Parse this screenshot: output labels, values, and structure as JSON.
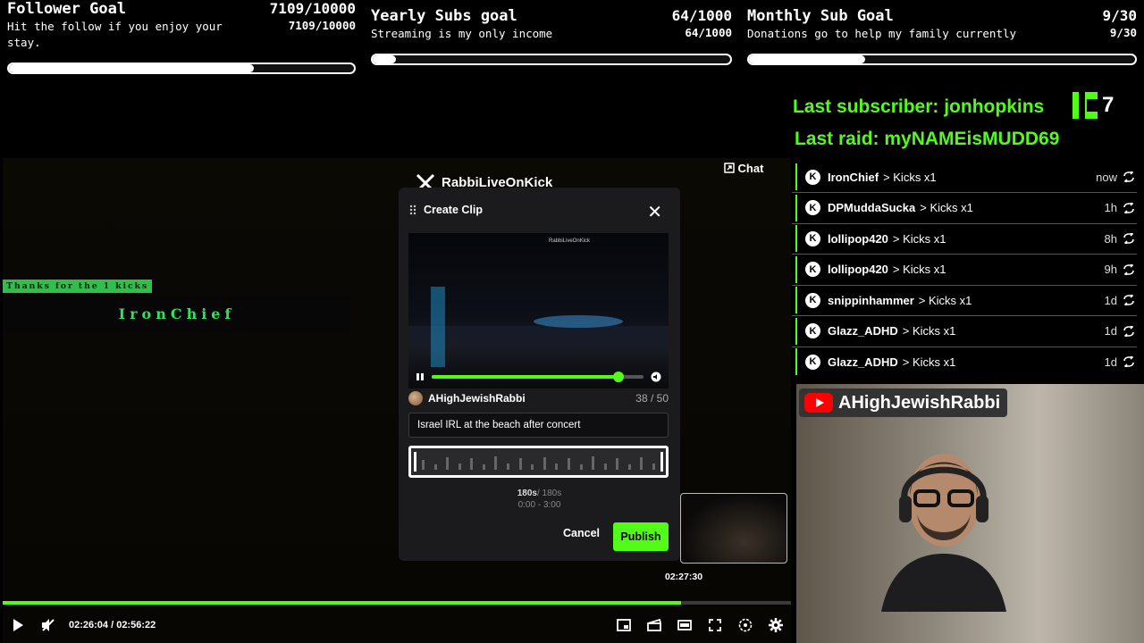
{
  "goals": [
    {
      "title": "Follower Goal",
      "count": "7109/10000",
      "desc": "Hit the follow if you enjoy your stay.",
      "count2": "7109/10000",
      "progress": 0.7109
    },
    {
      "title": "Yearly Subs goal",
      "count": "64/1000",
      "desc": "Streaming is my only income",
      "count2": "64/1000",
      "progress": 0.064
    },
    {
      "title": "Monthly Sub Goal",
      "count": "9/30",
      "desc": "Donations go to help my family currently",
      "count2": "9/30",
      "progress": 0.3
    }
  ],
  "alerts": {
    "last_subscriber": "Last subscriber: jonhopkins",
    "kick_count": "7",
    "last_raid": "Last raid: myNAMEisMUDD69",
    "accent": "#53fc18"
  },
  "overlay": {
    "thanks": "Thanks for the 1 kicks",
    "thanks_name": "IronChief"
  },
  "player": {
    "chat_label": "Chat",
    "channel": "RabbiLiveOnKick",
    "time": "02:26:04 / 02:56:22",
    "progress": 0.861,
    "thumb_time": "02:27:30"
  },
  "modal": {
    "title": "Create Clip",
    "author": "AHighJewishRabbi",
    "char_count": "38 / 50",
    "clip_title": "Israel IRL at the beach after concert",
    "clip_progress": 0.88,
    "duration_bold": "180s",
    "duration_max": "/ 180s",
    "range": "0:00 - 3:00",
    "cancel": "Cancel",
    "publish": "Publish"
  },
  "events": [
    {
      "user": "IronChief",
      "kicks": "> Kicks x1",
      "time": "now"
    },
    {
      "user": "DPMuddaSucka",
      "kicks": "> Kicks x1",
      "time": "1h"
    },
    {
      "user": "lollipop420",
      "kicks": "> Kicks x1",
      "time": "8h"
    },
    {
      "user": "lollipop420",
      "kicks": "> Kicks x1",
      "time": "9h"
    },
    {
      "user": "snippinhammer",
      "kicks": "> Kicks x1",
      "time": "1d"
    },
    {
      "user": "Glazz_ADHD",
      "kicks": "> Kicks x1",
      "time": "1d"
    },
    {
      "user": "Glazz_ADHD",
      "kicks": "> Kicks x1",
      "time": "1d"
    }
  ],
  "webcam": {
    "youtube_name": "AHighJewishRabbi"
  }
}
